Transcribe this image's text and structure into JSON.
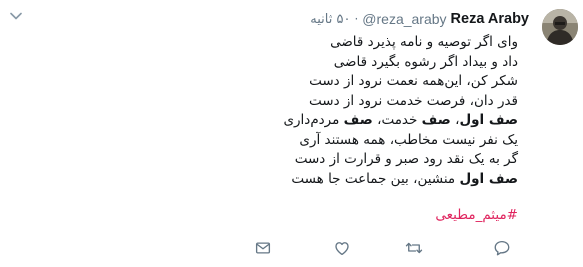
{
  "tweet": {
    "author_name": "Reza Araby",
    "author_handle": "@reza_araby",
    "separator": "·",
    "timestamp": "۵۰ ثانیه",
    "lines": [
      [
        {
          "text": "وای اگر توصیه و نامه پذیرد قاضی",
          "bold": false
        }
      ],
      [
        {
          "text": "داد و بیداد اگر رشوه بگیرد قاضی",
          "bold": false
        }
      ],
      [
        {
          "text": "شکر کن، این‌همه نعمت نرود از دست",
          "bold": false
        }
      ],
      [
        {
          "text": "قدر دان، فرصت خدمت نرود از دست",
          "bold": false
        }
      ],
      [
        {
          "text": "صف اول",
          "bold": true
        },
        {
          "text": "، ",
          "bold": false
        },
        {
          "text": "صف",
          "bold": true
        },
        {
          "text": " خدمت، ",
          "bold": false
        },
        {
          "text": "صف",
          "bold": true
        },
        {
          "text": " مردم‌داری",
          "bold": false
        }
      ],
      [
        {
          "text": "یک نفر نیست مخاطب، همه هستند آری",
          "bold": false
        }
      ],
      [
        {
          "text": "گر به یک نقد رود صبر و قرارت از دست",
          "bold": false
        }
      ],
      [
        {
          "text": "صف اول",
          "bold": true
        },
        {
          "text": " منشین، بین جماعت جا هست",
          "bold": false
        }
      ]
    ],
    "hashtag": "#میثم_مطیعی"
  },
  "icons": {
    "menu": "chevron-down-icon",
    "reply": "reply-icon",
    "retweet": "retweet-icon",
    "like": "heart-icon",
    "message": "envelope-icon"
  },
  "colors": {
    "text": "#14171a",
    "muted": "#657786",
    "hashtag": "#e0245e",
    "icon": "#657786"
  }
}
